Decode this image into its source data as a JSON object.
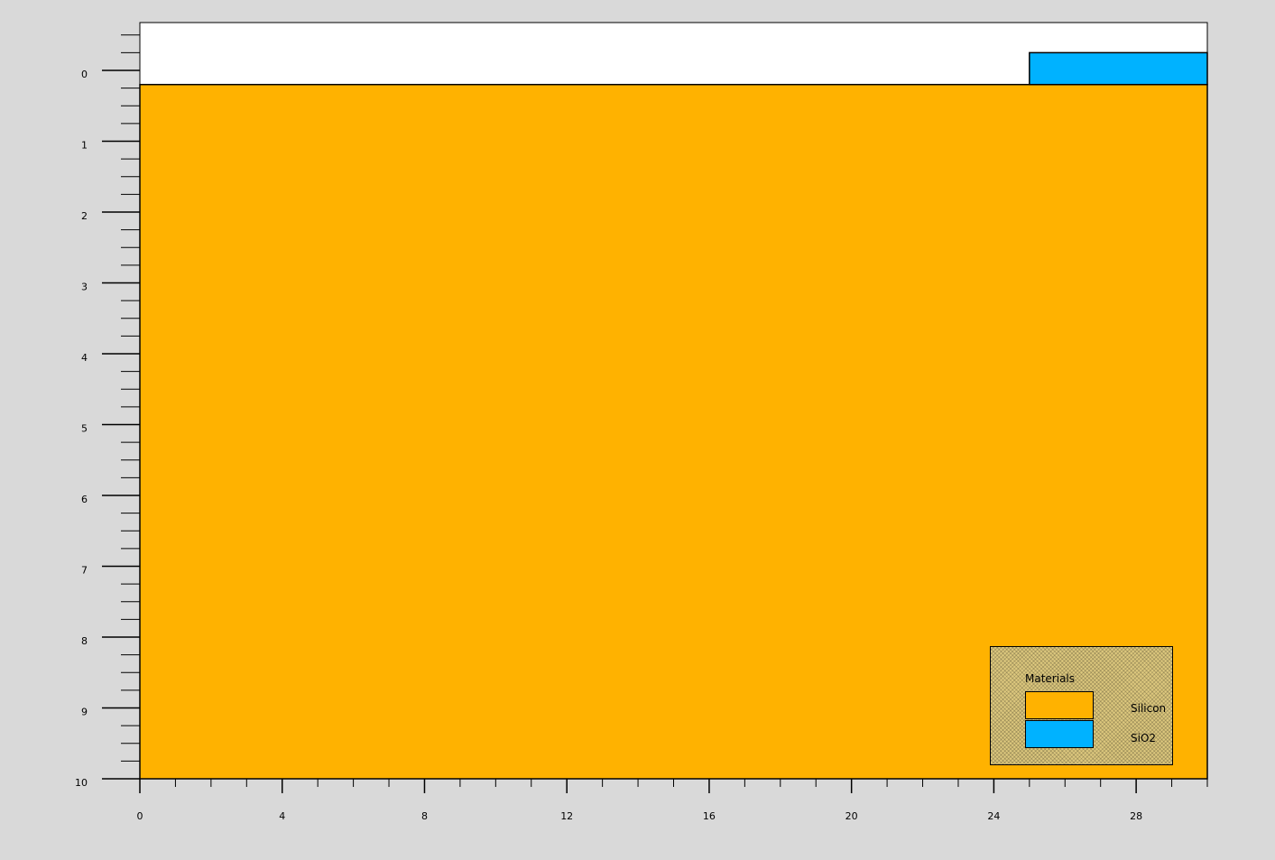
{
  "chart_data": {
    "type": "area",
    "xlim": [
      0,
      30
    ],
    "ylim": [
      0,
      10
    ],
    "y_reversed": true,
    "x_ticks": [
      0,
      4,
      8,
      12,
      16,
      20,
      24,
      28
    ],
    "y_ticks": [
      0,
      1,
      2,
      3,
      4,
      5,
      6,
      7,
      8,
      9,
      10
    ],
    "regions": [
      {
        "name": "Silicon",
        "color": "#ffb200",
        "x": [
          0,
          30
        ],
        "y": [
          0.2,
          10
        ]
      },
      {
        "name": "SiO2",
        "color": "#00b2ff",
        "x": [
          25,
          30
        ],
        "y": [
          -0.25,
          0.2
        ]
      }
    ],
    "legend": {
      "title": "Materials",
      "position": "bottom-right",
      "items": [
        {
          "label": "Silicon",
          "color": "#ffb200"
        },
        {
          "label": "SiO2",
          "color": "#00b2ff"
        }
      ]
    }
  }
}
